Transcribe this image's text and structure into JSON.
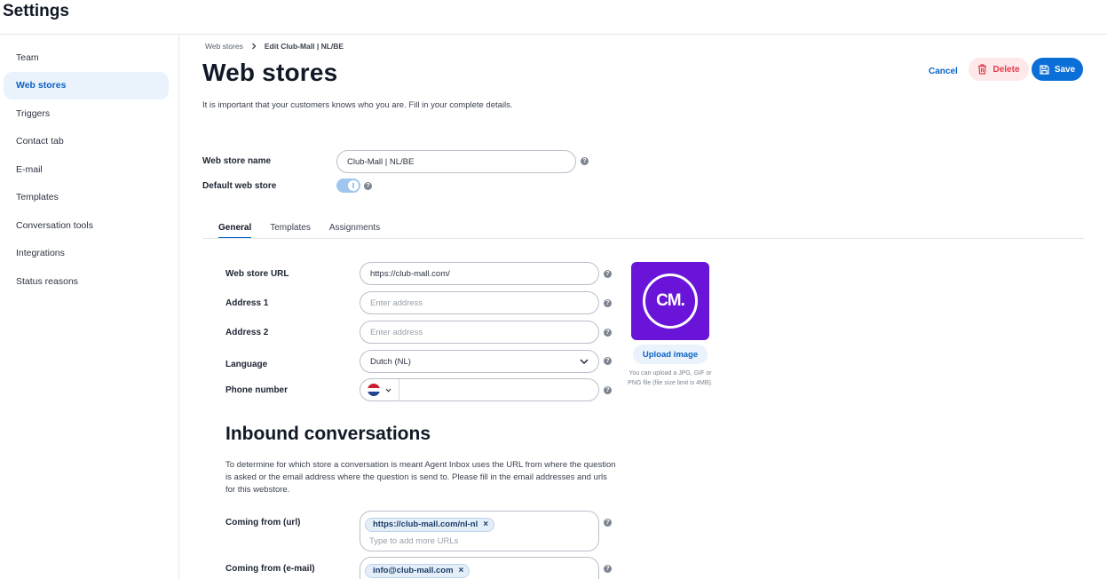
{
  "app": {
    "title": "Settings"
  },
  "sidebar": {
    "items": [
      {
        "label": "Team"
      },
      {
        "label": "Web stores",
        "active": true
      },
      {
        "label": "Triggers"
      },
      {
        "label": "Contact tab"
      },
      {
        "label": "E-mail"
      },
      {
        "label": "Templates"
      },
      {
        "label": "Conversation tools"
      },
      {
        "label": "Integrations"
      },
      {
        "label": "Status reasons"
      }
    ]
  },
  "breadcrumb": {
    "parent": "Web stores",
    "current": "Edit Club-Mall | NL/BE"
  },
  "header": {
    "title": "Web stores",
    "description": "It is important that your customers knows who you are. Fill in your complete details.",
    "cancel_label": "Cancel",
    "delete_label": "Delete",
    "save_label": "Save"
  },
  "store": {
    "name_label": "Web store name",
    "name_value": "Club-Mall | NL/BE",
    "default_label": "Default web store",
    "default_enabled": true
  },
  "tabs": [
    {
      "label": "General",
      "active": true
    },
    {
      "label": "Templates"
    },
    {
      "label": "Assignments"
    }
  ],
  "general": {
    "url_label": "Web store URL",
    "url_value": "https://club-mall.com/",
    "address1_label": "Address 1",
    "address1_placeholder": "Enter address",
    "address2_label": "Address 2",
    "address2_placeholder": "Enter address",
    "language_label": "Language",
    "language_value": "Dutch (NL)",
    "phone_label": "Phone number",
    "phone_country": "NL"
  },
  "logo": {
    "text": "CM.",
    "upload_label": "Upload image",
    "hint": "You can upload a JPG, GIF or PNG file (file size limit is 4MB)."
  },
  "inbound": {
    "title": "Inbound conversations",
    "description": "To determine for which store a conversation is meant Agent Inbox uses the URL from where the question is asked or the email address where the question is send to. Please fill in the email addresses and urls for this webstore.",
    "url_label": "Coming from (url)",
    "url_tags": [
      "https://club-mall.com/nl-nl"
    ],
    "url_placeholder": "Type to add more URLs",
    "email_label": "Coming from (e-mail)",
    "email_tags": [
      "info@club-mall.com"
    ]
  },
  "colors": {
    "accent": "#0b6fd8",
    "logo_bg": "#6a14d9",
    "delete_bg": "#fde8ea",
    "delete_text": "#e23b4b"
  }
}
